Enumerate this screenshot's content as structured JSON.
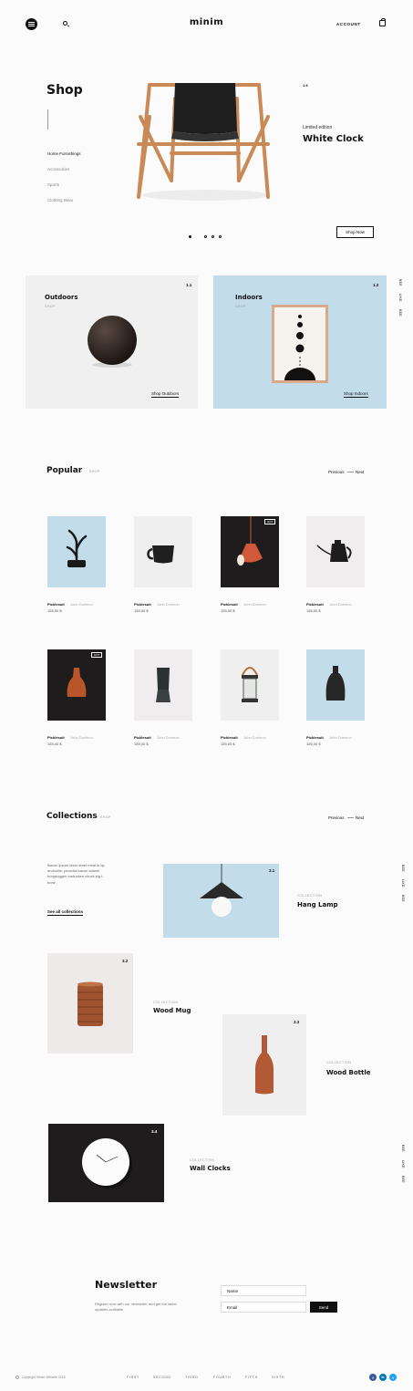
{
  "header": {
    "logo": "minim",
    "account": "ACCOUNT"
  },
  "hero": {
    "title": "Shop",
    "categories": [
      "Home Furnishings",
      "Accessories",
      "Sports",
      "Clothing Wear"
    ],
    "slide_number": "1.9",
    "kicker": "Limited edition",
    "product": "White Clock",
    "cta": "Shop Now",
    "slide_dots": 4,
    "active_slide": 1
  },
  "categories": [
    {
      "num": "1.1",
      "title": "Outdoors",
      "sub": "SHOP",
      "link": "Shop Outdoors",
      "bg": "#f0f0f0"
    },
    {
      "num": "1.2",
      "title": "Indoors",
      "sub": "SHOP",
      "link": "Shop Indoors",
      "bg": "#c2dcea"
    }
  ],
  "side_labels": [
    "BEE",
    "LIKE",
    "BEE"
  ],
  "popular": {
    "title": "Popular",
    "sub": "SHOP",
    "prev": "Previous",
    "next": "Next",
    "hot_label": "HOT",
    "products": [
      {
        "name": "Picklesuit",
        "author": "John Doeleon",
        "price": "155,00 $",
        "bg": "#c2dcea"
      },
      {
        "name": "Picklesuit",
        "author": "John Doeleon",
        "price": "155,00 $",
        "bg": "#efefef"
      },
      {
        "name": "Picklesuit",
        "author": "John Doeleon",
        "price": "155,00 $",
        "bg": "#1f1c1d"
      },
      {
        "name": "Picklesuit",
        "author": "John Doeleon",
        "price": "155,00 $",
        "bg": "#efeded"
      },
      {
        "name": "Picklesuit",
        "author": "John Doeleon",
        "price": "155,00 $",
        "bg": "#1f1c1d"
      },
      {
        "name": "Picklesuit",
        "author": "John Doeleon",
        "price": "155,00 $",
        "bg": "#efeded"
      },
      {
        "name": "Picklesuit",
        "author": "John Doeleon",
        "price": "155,00 $",
        "bg": "#efefef"
      },
      {
        "name": "Picklesuit",
        "author": "John Doeleon",
        "price": "155,00 $",
        "bg": "#c2dcea"
      }
    ]
  },
  "collections": {
    "title": "Collections",
    "sub": "SHOP",
    "prev": "Previous",
    "next": "Next",
    "intro": "Bacon ipsum dolor amet meat ki-tip andouille, picanha bacon salami burgdoggen turducken chuck pig t-bone",
    "see_all": "See all collections",
    "items": [
      {
        "num": "3.1",
        "label": "COLLECTION",
        "name": "Hang Lamp"
      },
      {
        "num": "3.2",
        "label": "COLLECTION",
        "name": "Wood Mug"
      },
      {
        "num": "3.3",
        "label": "COLLECTION",
        "name": "Wood Bottle"
      },
      {
        "num": "3.4",
        "label": "COLLECTION",
        "name": "Wall Clocks"
      }
    ]
  },
  "newsletter": {
    "title": "Newsletter",
    "text": "Register now with our newsletter and get the latest updates available",
    "name_placeholder": "Name",
    "email_placeholder": "Email",
    "send": "Send"
  },
  "footer": {
    "copyright": "Copyright Minim Website 2018",
    "links": [
      "FIRST",
      "SECOND",
      "THIRD",
      "FOURTH",
      "FIFTH",
      "SIXTH"
    ],
    "social": [
      "f",
      "in",
      "t"
    ]
  },
  "colors": {
    "dark": "#111111",
    "light_blue": "#c2dcea",
    "light_gray": "#f0f0f0",
    "wood": "#c98a57",
    "facebook": "#3b5998",
    "linkedin": "#0077b5",
    "twitter": "#1da1f2"
  }
}
